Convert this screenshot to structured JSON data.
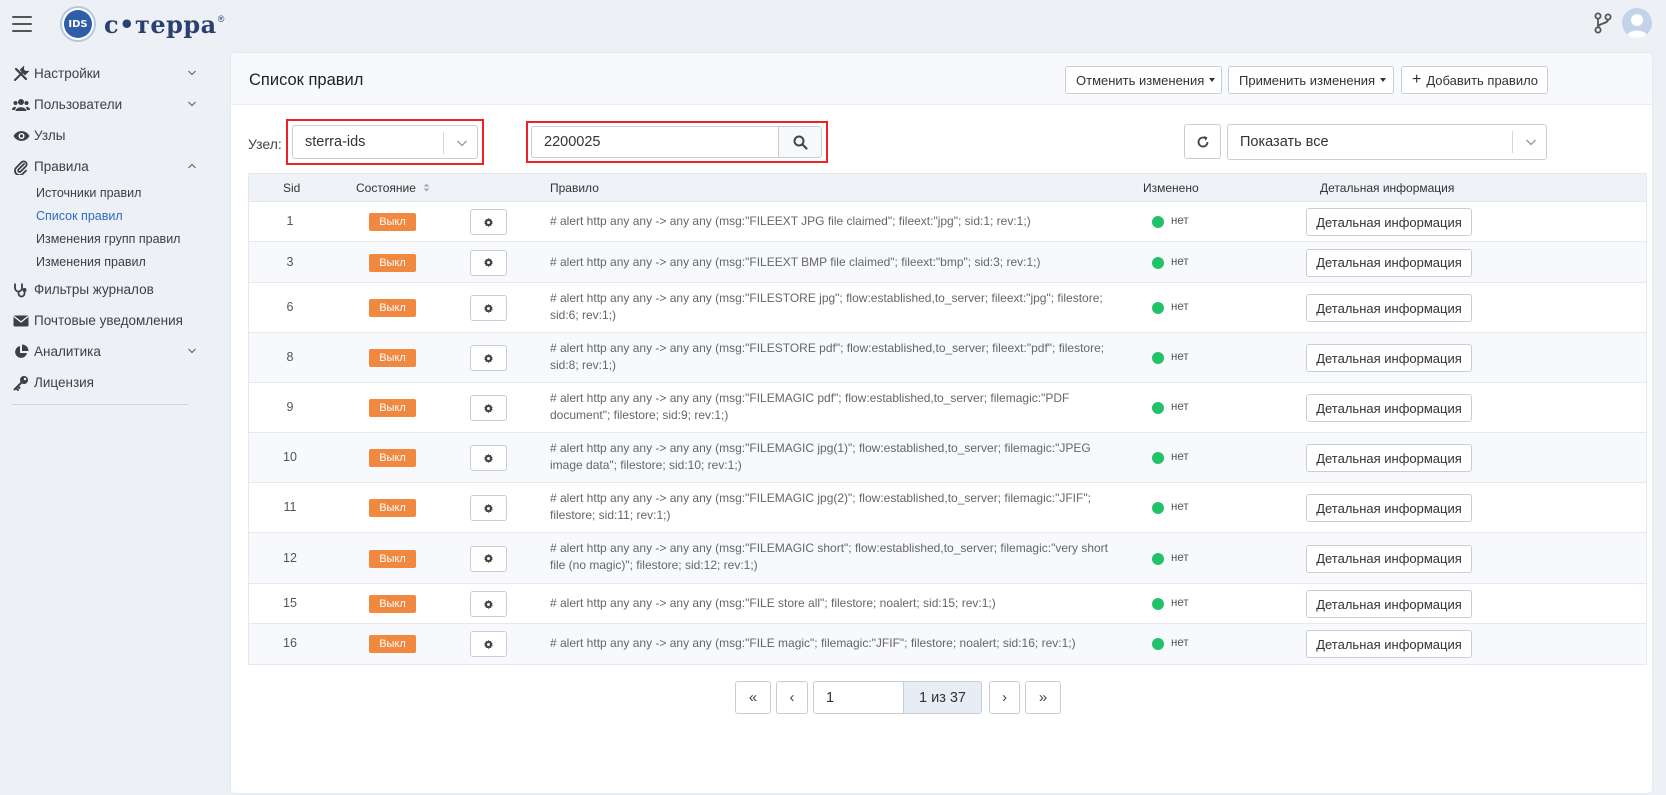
{
  "logo": {
    "badge_text": "IDS",
    "brand_text": "с•терра",
    "registered": "®"
  },
  "sidebar": {
    "items": [
      {
        "label": "Настройки",
        "icon": "tools-icon",
        "chevron": "down"
      },
      {
        "label": "Пользователи",
        "icon": "users-icon",
        "chevron": "down"
      },
      {
        "label": "Узлы",
        "icon": "eye-icon"
      },
      {
        "label": "Правила",
        "icon": "paperclip-icon",
        "chevron": "up"
      },
      {
        "label": "Фильтры журналов",
        "icon": "stethoscope-icon"
      },
      {
        "label": "Почтовые уведомления",
        "icon": "envelope-icon"
      },
      {
        "label": "Аналитика",
        "icon": "pie-chart-icon",
        "chevron": "down"
      },
      {
        "label": "Лицензия",
        "icon": "key-icon"
      }
    ],
    "rules_subitems": [
      {
        "label": "Источники правил"
      },
      {
        "label": "Список правил",
        "active": true
      },
      {
        "label": "Изменения групп правил"
      },
      {
        "label": "Изменения правил"
      }
    ]
  },
  "header": {
    "title": "Список правил",
    "cancel_label": "Отменить изменения",
    "apply_label": "Применить изменения",
    "add_label": "Добавить правило"
  },
  "filters": {
    "node_label": "Узел:",
    "node_value": "sterra-ids",
    "search_value": "2200025",
    "show_value": "Показать все"
  },
  "table": {
    "headers": {
      "sid": "Sid",
      "state": "Состояние",
      "rule": "Правило",
      "changed": "Изменено",
      "detail": "Детальная информация"
    },
    "rows": [
      {
        "sid": "1",
        "state": "Выкл",
        "rule": "# alert http any any -> any any (msg:\"FILEEXT JPG file claimed\"; fileext:\"jpg\"; sid:1; rev:1;)",
        "changed": "нет",
        "detail": "Детальная информация"
      },
      {
        "sid": "3",
        "state": "Выкл",
        "rule": "# alert http any any -> any any (msg:\"FILEEXT BMP file claimed\"; fileext:\"bmp\"; sid:3; rev:1;)",
        "changed": "нет",
        "detail": "Детальная информация"
      },
      {
        "sid": "6",
        "state": "Выкл",
        "rule": "# alert http any any -> any any (msg:\"FILESTORE jpg\"; flow:established,to_server; fileext:\"jpg\"; filestore; sid:6; rev:1;)",
        "changed": "нет",
        "detail": "Детальная информация"
      },
      {
        "sid": "8",
        "state": "Выкл",
        "rule": "# alert http any any -> any any (msg:\"FILESTORE pdf\"; flow:established,to_server; fileext:\"pdf\"; filestore; sid:8; rev:1;)",
        "changed": "нет",
        "detail": "Детальная информация"
      },
      {
        "sid": "9",
        "state": "Выкл",
        "rule": "# alert http any any -> any any (msg:\"FILEMAGIC pdf\"; flow:established,to_server; filemagic:\"PDF document\"; filestore; sid:9; rev:1;)",
        "changed": "нет",
        "detail": "Детальная информация"
      },
      {
        "sid": "10",
        "state": "Выкл",
        "rule": "# alert http any any -> any any (msg:\"FILEMAGIC jpg(1)\"; flow:established,to_server; filemagic:\"JPEG image data\"; filestore; sid:10; rev:1;)",
        "changed": "нет",
        "detail": "Детальная информация"
      },
      {
        "sid": "11",
        "state": "Выкл",
        "rule": "# alert http any any -> any any (msg:\"FILEMAGIC jpg(2)\"; flow:established,to_server; filemagic:\"JFIF\"; filestore; sid:11; rev:1;)",
        "changed": "нет",
        "detail": "Детальная информация"
      },
      {
        "sid": "12",
        "state": "Выкл",
        "rule": "# alert http any any -> any any (msg:\"FILEMAGIC short\"; flow:established,to_server; filemagic:\"very short file (no magic)\"; filestore; sid:12; rev:1;)",
        "changed": "нет",
        "detail": "Детальная информация"
      },
      {
        "sid": "15",
        "state": "Выкл",
        "rule": "# alert http any any -> any any (msg:\"FILE store all\"; filestore; noalert; sid:15; rev:1;)",
        "changed": "нет",
        "detail": "Детальная информация"
      },
      {
        "sid": "16",
        "state": "Выкл",
        "rule": "# alert http any any -> any any (msg:\"FILE magic\"; filemagic:\"JFIF\"; filestore; noalert; sid:16; rev:1;)",
        "changed": "нет",
        "detail": "Детальная информация"
      }
    ]
  },
  "pagination": {
    "first": "«",
    "prev": "‹",
    "page_value": "1",
    "info": "1 из 37",
    "next": "›",
    "last": "»"
  },
  "colors": {
    "accent": "#2f6bc4",
    "badge_off": "#f0883f",
    "status_dot": "#21c26a",
    "highlight_box": "#e22222"
  }
}
